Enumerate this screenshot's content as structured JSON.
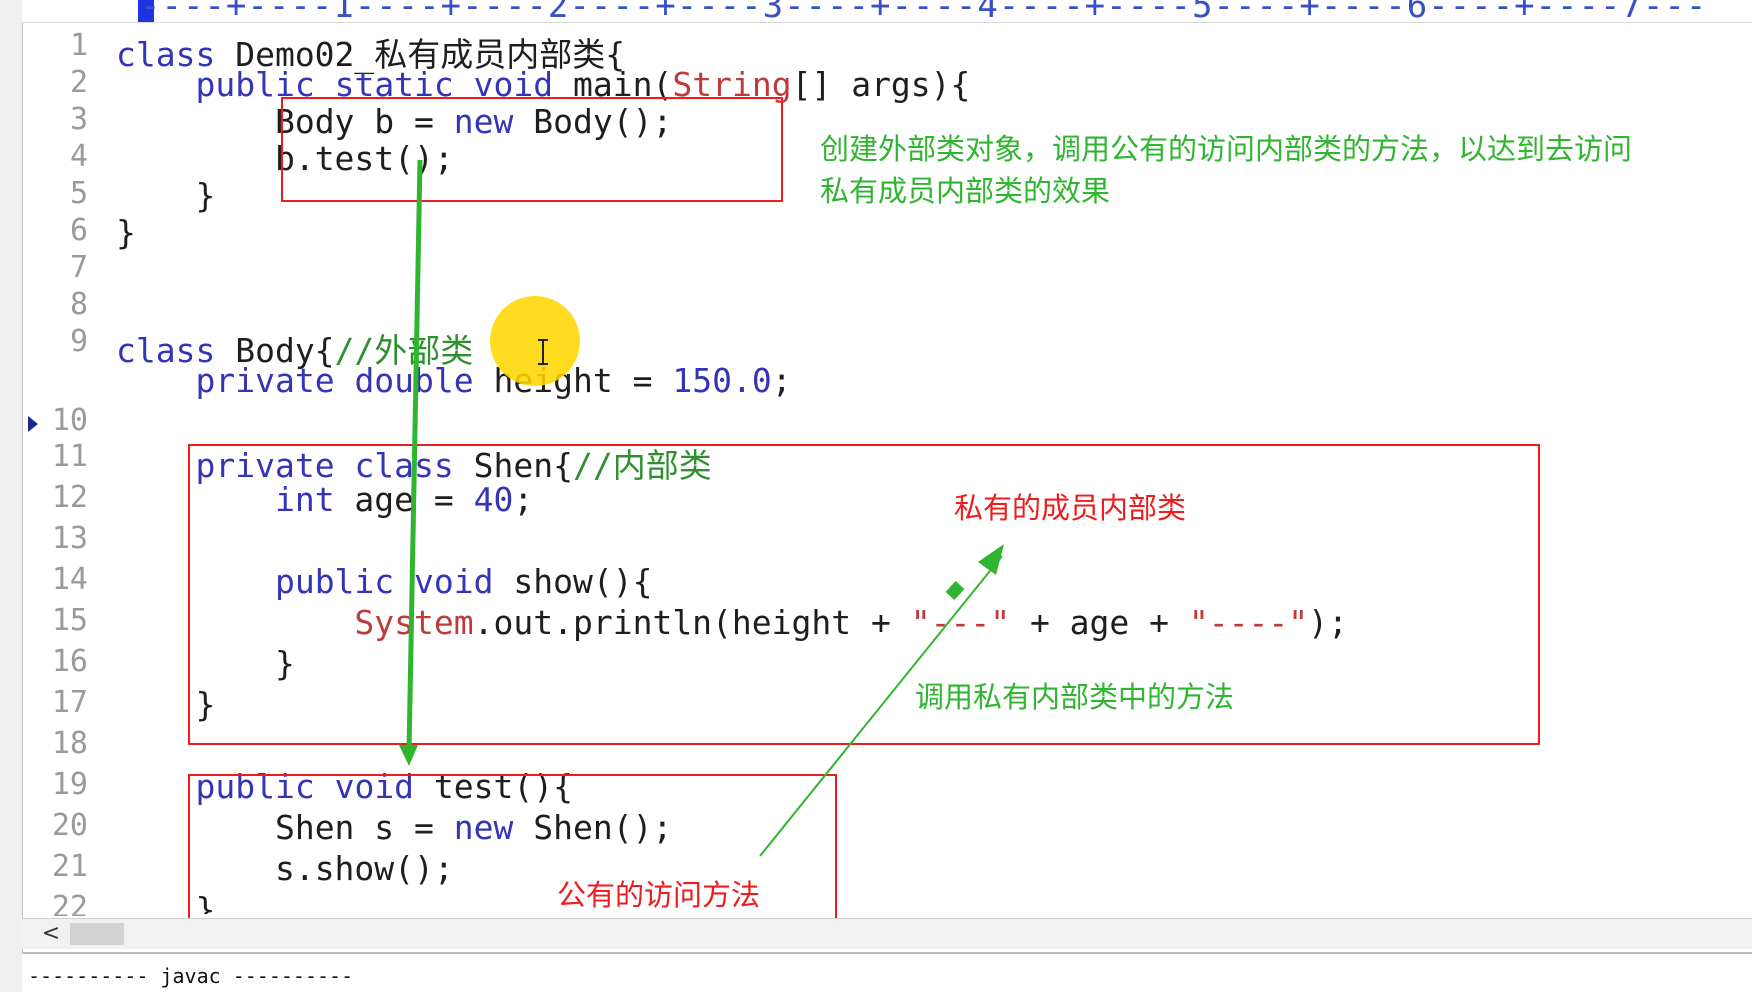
{
  "ruler": {
    "text": "----+----1----+----2----+----3----+----4----+----5----+----6----+----7---"
  },
  "line_numbers": [
    "1",
    "2",
    "3",
    "4",
    "5",
    "6",
    "7",
    "8",
    "9",
    "10",
    "11",
    "12",
    "13",
    "14",
    "15",
    "16",
    "17",
    "18",
    "19",
    "20",
    "21",
    "22"
  ],
  "current_line": "10",
  "code": {
    "l1": {
      "kw": "class",
      "rest": " Demo02_私有成员内部类{"
    },
    "l2": {
      "indent": "    ",
      "kw1": "public",
      "sp1": " ",
      "kw2": "static",
      "sp2": " ",
      "kw3": "void",
      "mid": " main(",
      "cls": "String",
      "rest": "[] args){"
    },
    "l3": {
      "indent": "        ",
      "pre": "Body b = ",
      "kw": "new",
      "rest": " Body();"
    },
    "l4": {
      "indent": "        ",
      "text": "b.test();"
    },
    "l5": {
      "indent": "    ",
      "text": "}"
    },
    "l6": {
      "text": "}"
    },
    "l8": {
      "kw": "class",
      "mid": " Body{",
      "comment": "//外部类"
    },
    "l9": {
      "indent": "    ",
      "kw1": "private",
      "sp1": " ",
      "kw2": "double",
      "mid": " height = ",
      "num": "150.0",
      "rest": ";"
    },
    "l11": {
      "indent": "    ",
      "kw1": "private",
      "sp1": " ",
      "kw2": "class",
      "mid": " Shen{",
      "comment": "//内部类"
    },
    "l12": {
      "indent": "        ",
      "kw": "int",
      "mid": " age = ",
      "num": "40",
      "rest": ";"
    },
    "l14": {
      "indent": "        ",
      "kw1": "public",
      "sp1": " ",
      "kw2": "void",
      "rest": " show(){"
    },
    "l15": {
      "indent": "            ",
      "cls": "System",
      "mid": ".out.println(height + ",
      "s1": "\"---\"",
      "mid2": " + age + ",
      "s2": "\"----\"",
      "rest": ");"
    },
    "l16": {
      "indent": "        ",
      "text": "}"
    },
    "l17": {
      "indent": "    ",
      "text": "}"
    },
    "l19": {
      "indent": "    ",
      "kw1": "public",
      "sp1": " ",
      "kw2": "void",
      "rest": " test(){"
    },
    "l20": {
      "indent": "        ",
      "pre": "Shen s = ",
      "kw": "new",
      "rest": " Shen();"
    },
    "l21": {
      "indent": "        ",
      "text": "s.show();"
    },
    "l22": {
      "indent": "    ",
      "text": "}"
    }
  },
  "annotations": {
    "create_outer": "创建外部类对象，调用公有的访问内部类的方法，以达到去访问\n私有成员内部类的效果",
    "private_member_inner": "私有的成员内部类",
    "call_private_method": "调用私有内部类中的方法",
    "public_access_method": "公有的访问方法"
  },
  "colors": {
    "keyword": "#3434b6",
    "string": "#c03a3a",
    "comment": "#2f8f2f",
    "box": "#ee1c1c",
    "note_green": "#2fb52f",
    "note_red": "#ee1c1c",
    "highlight": "#ffd600"
  },
  "scrollbar": {
    "left_arrow": "<"
  },
  "output": {
    "text": "---------- javac ----------"
  }
}
